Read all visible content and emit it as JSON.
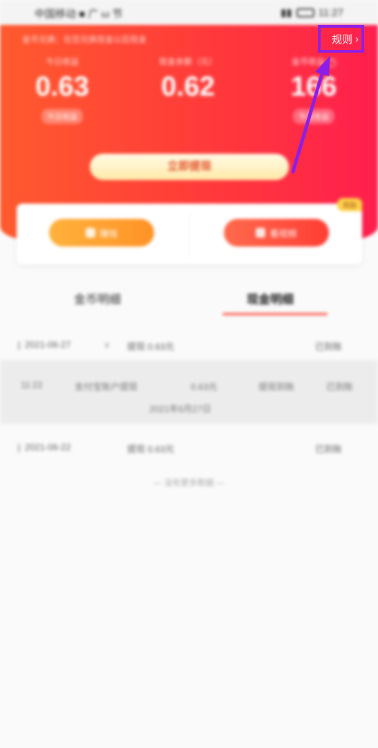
{
  "status_bar": {
    "carrier": "中国移动 ■ 广 ω 节",
    "time": "11:27"
  },
  "header": {
    "notice": "金币兑换：在您兑换现金以后现金",
    "rules_label": "规则",
    "stats": [
      {
        "label": "今日收益",
        "value": "0.63",
        "sub": "今日收益"
      },
      {
        "label": "现金余额（元）",
        "value": "0.62",
        "sub": ""
      },
      {
        "label": "金币收益",
        "value": "166",
        "sub": "今日收益"
      }
    ],
    "withdraw_label": "立即提现"
  },
  "actions": {
    "left_label": "赚钱",
    "right_label": "看视频",
    "badge": "奖励"
  },
  "tabs": [
    {
      "label": "金币明细",
      "active": false
    },
    {
      "label": "现金明细",
      "active": true
    }
  ],
  "records": [
    {
      "date": "2021-06-27",
      "summary": "提现 0.63元",
      "status": "已到账"
    },
    {
      "date": "2021-06-22",
      "summary": "提现 0.63元",
      "status": "已到账"
    }
  ],
  "detail": {
    "c1": "11:22",
    "c2": "支付宝账户提现",
    "c3": "0.63元",
    "c4": "提现到账",
    "c5": "已到账",
    "c6": "2021年6月27日"
  },
  "end_note": "— 没有更多数据 —",
  "colors": {
    "header_start": "#ff5a2e",
    "header_end": "#ff1f4e",
    "annotation": "#8b1fe8"
  }
}
